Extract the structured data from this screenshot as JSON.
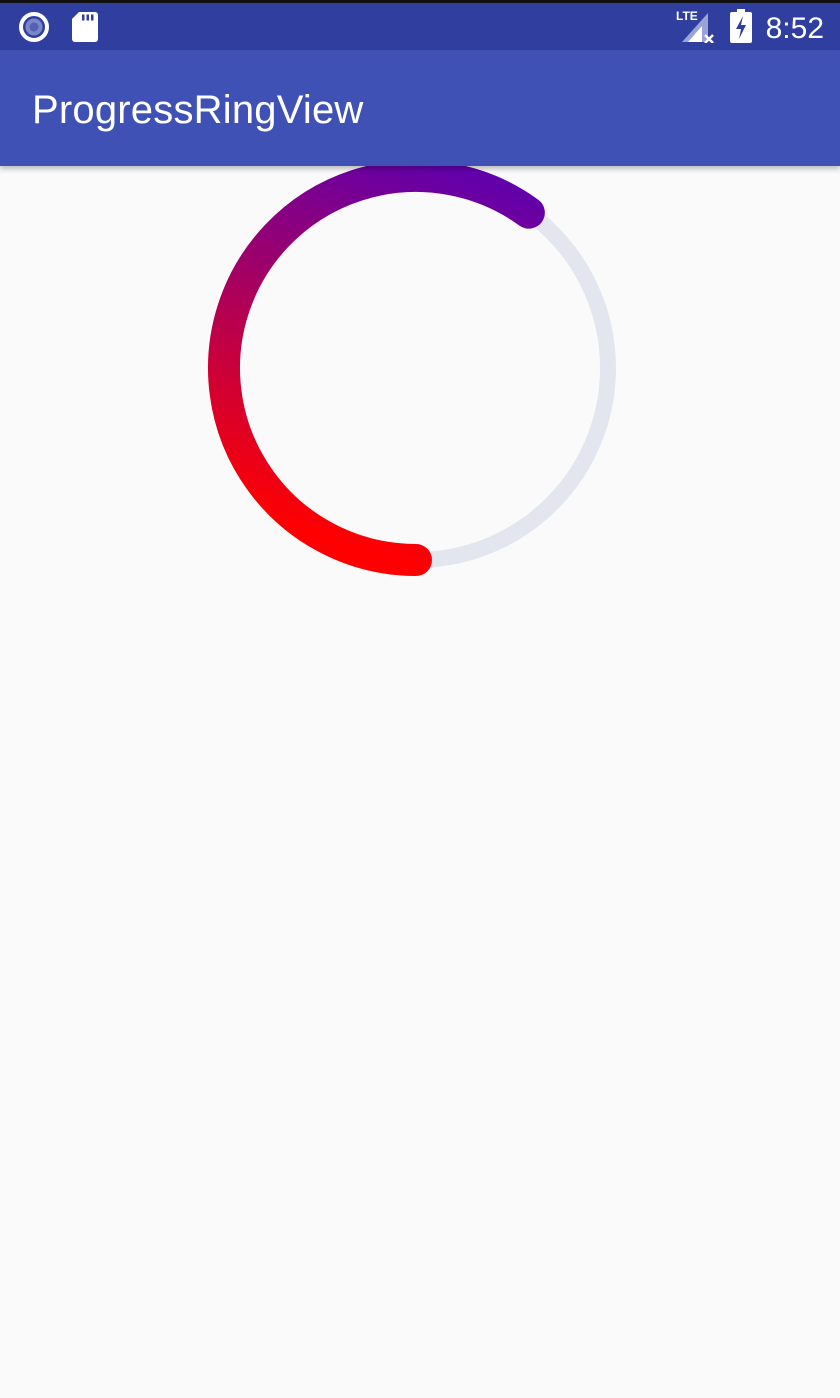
{
  "status_bar": {
    "time": "8:52",
    "network": "LTE",
    "left_icons": [
      "radio-record-icon",
      "sd-card-icon"
    ],
    "right_icons": [
      "lte-signal-icon",
      "battery-charging-icon"
    ]
  },
  "app_bar": {
    "title": "ProgressRingView",
    "color": "#3f51b5"
  },
  "progress_ring": {
    "progress": 0.6,
    "track_color": "#e3e6ee",
    "gradient_start_color": "#ff0000",
    "gradient_end_color": "#6200aa"
  }
}
